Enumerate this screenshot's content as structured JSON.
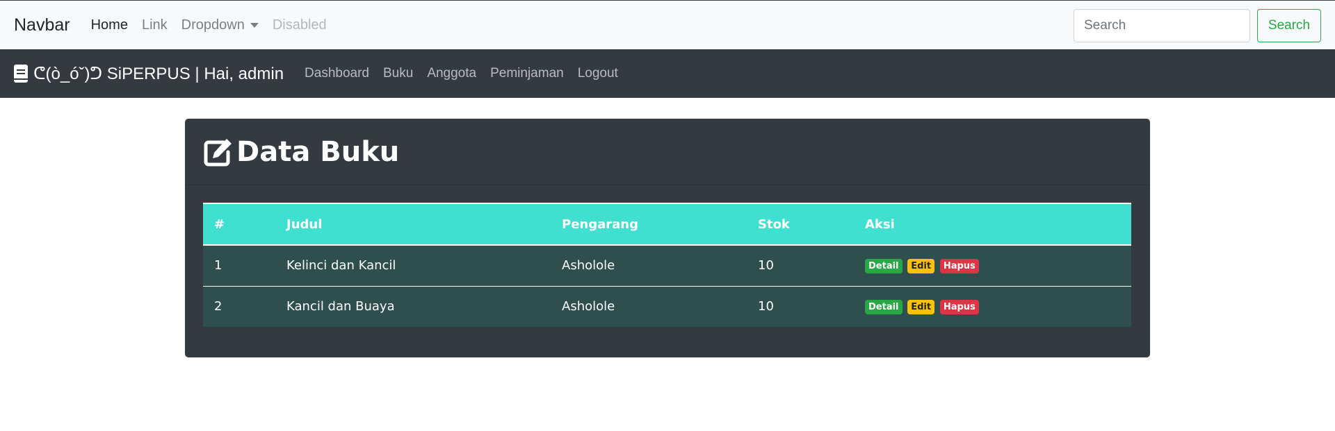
{
  "top_nav": {
    "brand": "Navbar",
    "links": [
      "Home",
      "Link",
      "Dropdown",
      "Disabled"
    ],
    "search_placeholder": "Search",
    "search_button": "Search"
  },
  "app_nav": {
    "brand": "ᕦ(ò_óˇ)ᕤ SiPERPUS | Hai, admin",
    "links": [
      "Dashboard",
      "Buku",
      "Anggota",
      "Peminjaman",
      "Logout"
    ]
  },
  "card": {
    "title": "Data Buku",
    "table": {
      "headers": [
        "#",
        "Judul",
        "Pengarang",
        "Stok",
        "Aksi"
      ],
      "rows": [
        {
          "num": "1",
          "judul": "Kelinci dan Kancil",
          "pengarang": "Asholole",
          "stok": "10"
        },
        {
          "num": "2",
          "judul": "Kancil dan Buaya",
          "pengarang": "Asholole",
          "stok": "10"
        }
      ],
      "actions": {
        "detail": "Detail",
        "edit": "Edit",
        "hapus": "Hapus"
      }
    }
  },
  "colors": {
    "header_row": "#40e0d0",
    "body_row": "#2f4f4f",
    "card_bg": "#343a40",
    "success": "#28a745",
    "warning": "#ffc107",
    "danger": "#dc3545"
  }
}
